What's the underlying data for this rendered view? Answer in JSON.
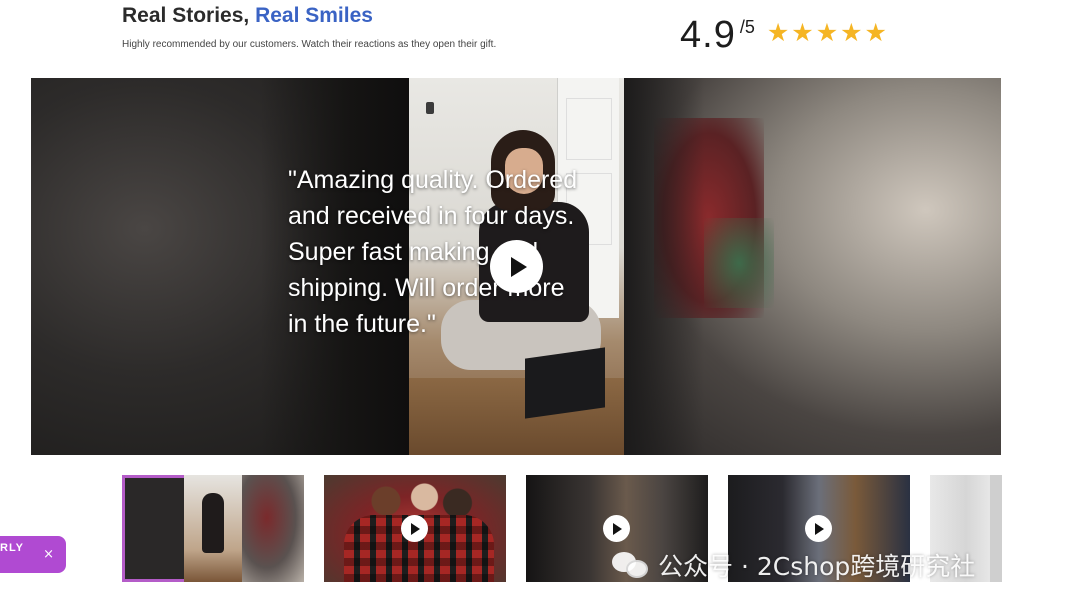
{
  "header": {
    "title_part1": "Real Stories, ",
    "title_part2": "Real Smiles",
    "subtitle": "Highly recommended by our customers. Watch their reactions as they open their gift."
  },
  "rating": {
    "score": "4.9",
    "out_of": "/5",
    "stars": [
      "★",
      "★",
      "★",
      "★",
      "★"
    ],
    "star_color": "#f5b524"
  },
  "featured_video": {
    "quote": "\"Amazing quality. Ordered and received in four days. Super fast making and shipping. Will order more in the future.\"",
    "play_icon": "play-icon"
  },
  "thumbnails": [
    {
      "active": true,
      "has_play": false
    },
    {
      "active": false,
      "has_play": true
    },
    {
      "active": false,
      "has_play": true
    },
    {
      "active": false,
      "has_play": true
    },
    {
      "active": false,
      "has_play": false
    }
  ],
  "promo": {
    "label": "RLY",
    "close": "×",
    "color": "#b04ad2"
  },
  "watermark": {
    "text": "公众号 · 2Cshop跨境研究社"
  },
  "colors": {
    "accent": "#3a63c4",
    "active_border": "#b45cc8"
  }
}
